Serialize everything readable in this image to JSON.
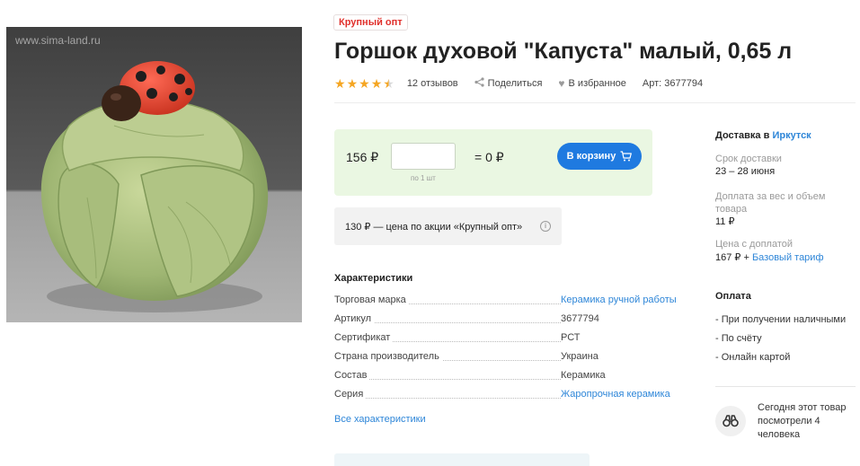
{
  "image": {
    "watermark": "www.sima-land.ru"
  },
  "badge": "Крупный опт",
  "title": "Горшок духовой \"Капуста\" малый, 0,65 л",
  "meta": {
    "rating": 4.5,
    "reviews": "12 отзывов",
    "share": "Поделиться",
    "favorite": "В избранное",
    "article": "Арт: 3677794"
  },
  "buy": {
    "price": "156 ₽",
    "qty_value": "",
    "qty_note": "по 1 шт",
    "total": "= 0 ₽",
    "cart_label": "В корзину"
  },
  "promo": {
    "text": "130 ₽ — цена по акции «Крупный опт»"
  },
  "specs": {
    "title": "Характеристики",
    "rows": [
      {
        "key": "Торговая марка",
        "value": "Керамика ручной работы",
        "link": true
      },
      {
        "key": "Артикул",
        "value": "3677794",
        "link": false
      },
      {
        "key": "Сертификат",
        "value": "РСТ",
        "link": false
      },
      {
        "key": "Страна производитель",
        "value": "Украина",
        "link": false
      },
      {
        "key": "Состав",
        "value": "Керамика",
        "link": false
      },
      {
        "key": "Серия",
        "value": "Жаропрочная керамика",
        "link": true
      }
    ],
    "all_link": "Все характеристики"
  },
  "delivery": {
    "title_prefix": "Доставка в",
    "city": "Иркутск",
    "term_label": "Срок доставки",
    "term_value": "23 – 28 июня",
    "extra_label": "Доплата за вес и объем товара",
    "extra_value": "11 ₽",
    "total_label": "Цена с доплатой",
    "total_value": "167 ₽ +",
    "tariff": "Базовый тариф"
  },
  "payment": {
    "title": "Оплата",
    "items": [
      "- При получении наличными",
      "- По счёту",
      "- Онлайн картой"
    ]
  },
  "viewers": {
    "text": "Сегодня этот товар посмотрели 4 человека"
  },
  "colors": {
    "accent": "#1f7ae0",
    "link": "#2e86d8",
    "badge": "#e0302c",
    "buy_bg": "#eaf7e2",
    "star": "#f5a623"
  }
}
